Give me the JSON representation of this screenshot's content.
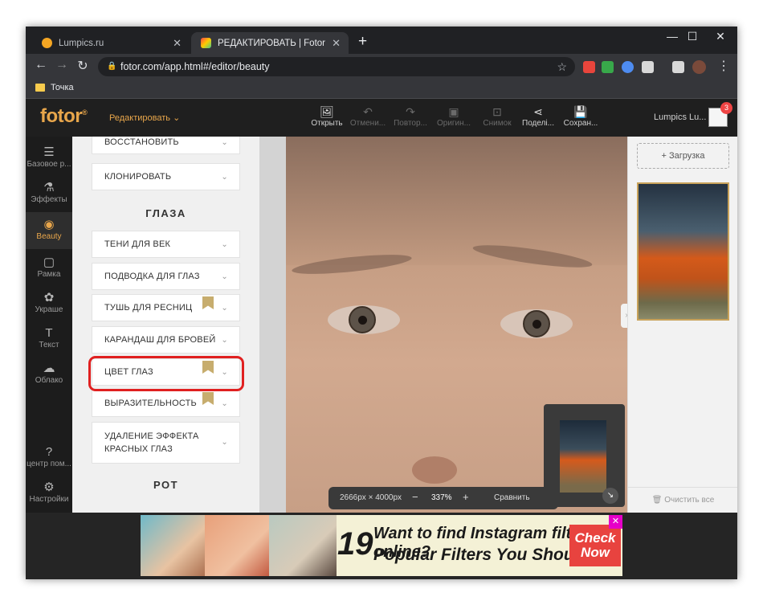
{
  "browser": {
    "tabs": [
      {
        "title": "Lumpics.ru",
        "active": false
      },
      {
        "title": "РЕДАКТИРОВАТЬ | Fotor",
        "active": true
      }
    ],
    "url": "fotor.com/app.html#/editor/beauty",
    "bookmark": "Точка",
    "extensions": [
      {
        "name": "ext-red-icon",
        "color": "#e8453c"
      },
      {
        "name": "ext-check-icon",
        "color": "#38a84a"
      },
      {
        "name": "ext-globe-icon",
        "color": "#4e8cf0"
      },
      {
        "name": "ext-cube-icon",
        "color": "#d8d8d8"
      },
      {
        "name": "ext-music-icon",
        "color": "#d8d8d8"
      }
    ]
  },
  "app": {
    "logo": "fotor",
    "logo_mark": "®",
    "edit_menu": "Редактировать",
    "tools": [
      {
        "label": "Открыть",
        "icon": "open-image-icon",
        "enabled": true
      },
      {
        "label": "Отмени...",
        "icon": "undo-icon",
        "enabled": false
      },
      {
        "label": "Повтор...",
        "icon": "redo-icon",
        "enabled": false
      },
      {
        "label": "Оригин...",
        "icon": "original-icon",
        "enabled": false
      },
      {
        "label": "Снимок",
        "icon": "snapshot-icon",
        "enabled": false
      },
      {
        "label": "Поделі...",
        "icon": "share-icon",
        "enabled": true
      },
      {
        "label": "Сохран...",
        "icon": "save-icon",
        "enabled": true
      }
    ],
    "user": "Lumpics Lu...",
    "notifications": "3"
  },
  "rail": [
    {
      "label": "Базовое р...",
      "icon": "sliders-icon",
      "active": false
    },
    {
      "label": "Эффекты",
      "icon": "flask-icon",
      "active": false
    },
    {
      "label": "Beauty",
      "icon": "eye-icon",
      "active": true
    },
    {
      "label": "Рамка",
      "icon": "frame-icon",
      "active": false
    },
    {
      "label": "Украше",
      "icon": "decoration-icon",
      "active": false
    },
    {
      "label": "Текст",
      "icon": "text-icon",
      "active": false
    },
    {
      "label": "Облако",
      "icon": "cloud-icon",
      "active": false
    },
    {
      "label": "центр пом...",
      "icon": "help-icon",
      "active": false
    },
    {
      "label": "Настройки",
      "icon": "gear-icon",
      "active": false
    }
  ],
  "panel": {
    "items_top": [
      "ВОССТАНОВИТЬ",
      "КЛОНИРОВАТЬ"
    ],
    "section_eyes": "ГЛАЗА",
    "eye_items": [
      {
        "label": "ТЕНИ ДЛЯ ВЕК",
        "premium": false
      },
      {
        "label": "ПОДВОДКА ДЛЯ ГЛАЗ",
        "premium": false
      },
      {
        "label": "ТУШЬ ДЛЯ РЕСНИЦ",
        "premium": true
      },
      {
        "label": "КАРАНДАШ ДЛЯ БРОВЕЙ",
        "premium": false
      },
      {
        "label": "ЦВЕТ ГЛАЗ",
        "premium": true
      },
      {
        "label": "ВЫРАЗИТЕЛЬНОСТЬ",
        "premium": true
      }
    ],
    "red_eye_line1": "УДАЛЕНИЕ ЭФФЕКТА",
    "red_eye_line2": "КРАСНЫХ ГЛАЗ",
    "section_mouth": "РОТ"
  },
  "canvas": {
    "dimensions": "2666px × 4000px",
    "zoom": "337%",
    "compare": "Сравнить"
  },
  "right": {
    "upload": "Загрузка",
    "clear_all": "Очистить все"
  },
  "ad": {
    "number": "19",
    "line1": "Want to find Instagram filters online?",
    "line2": "Popular Filters You Should Try",
    "cta1": "Check",
    "cta2": "Now"
  }
}
